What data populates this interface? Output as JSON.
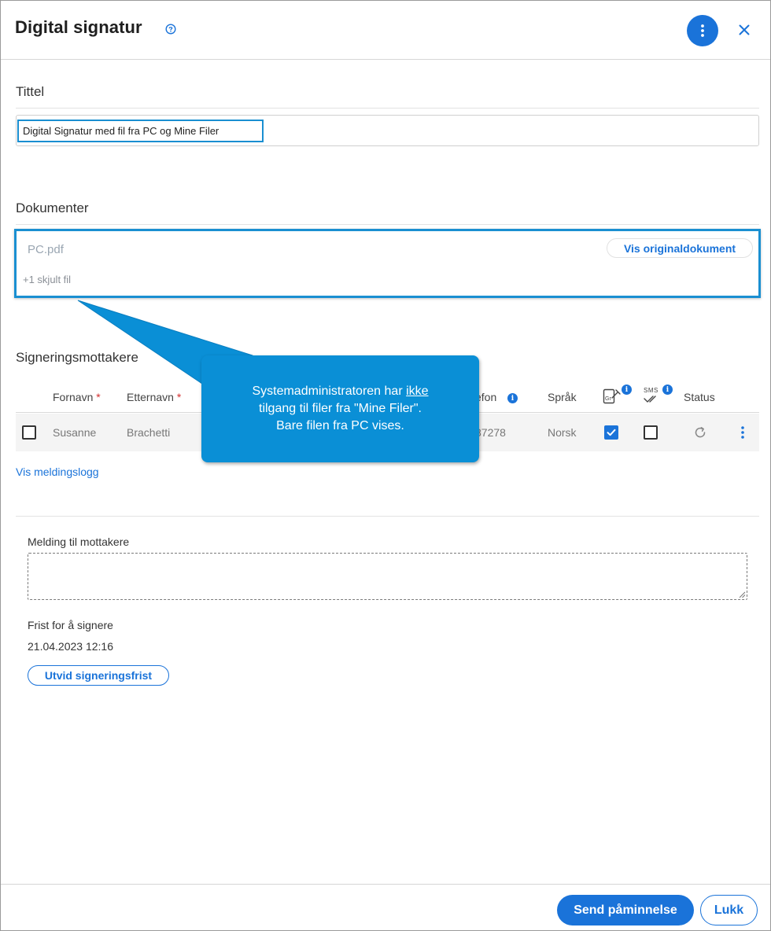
{
  "header": {
    "title": "Digital signatur"
  },
  "title_section": {
    "label": "Tittel",
    "value": "Digital Signatur med fil fra PC og Mine Filer"
  },
  "documents": {
    "label": "Dokumenter",
    "file_name": "PC.pdf",
    "view_original_label": "Vis originaldokument",
    "hidden_files_text": "+1 skjult fil"
  },
  "callout": {
    "line1_before": "Systemadministratoren har ",
    "line1_underlined": "ikke",
    "line2": "tilgang til filer fra \"Mine Filer\".",
    "line3": "Bare filen fra PC vises."
  },
  "recipients": {
    "label": "Signeringsmottakere",
    "columns": {
      "first_name": "Fornavn",
      "last_name": "Etternavn",
      "phone": "efon",
      "language": "Språk",
      "sign_icon_text": "Gr",
      "sms_icon_text": "SMS",
      "status": "Status",
      "required_mark": "*",
      "info_mark": "i"
    },
    "rows": [
      {
        "first_name": "Susanne",
        "last_name": "Brachetti",
        "phone": "87278",
        "language": "Norsk",
        "sign_checked": true,
        "sms_checked": false
      }
    ],
    "view_log_label": "Vis meldingslogg"
  },
  "message": {
    "label": "Melding til mottakere",
    "value": ""
  },
  "deadline": {
    "label": "Frist for å signere",
    "value": "21.04.2023 12:16",
    "extend_label": "Utvid signeringsfrist"
  },
  "footer": {
    "send_reminder_label": "Send påminnelse",
    "close_label": "Lukk"
  },
  "colors": {
    "accent": "#1a73d9",
    "callout": "#0a8fd6",
    "highlight": "#1a8fd1",
    "required": "#d32f2f"
  },
  "icons": {
    "help": "help-circle-icon",
    "more": "kebab-menu-icon",
    "close": "close-icon",
    "sign": "signature-icon",
    "sms": "sms-icon",
    "resend": "refresh-icon",
    "row_menu": "kebab-menu-icon"
  }
}
